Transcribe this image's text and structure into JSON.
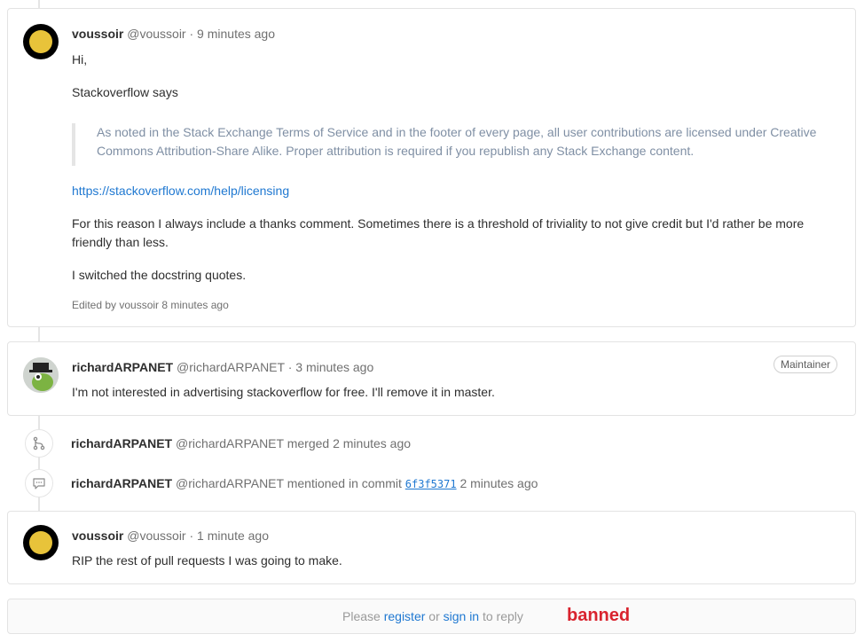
{
  "notes": [
    {
      "author": "voussoir",
      "handle": "@voussoir",
      "separator": "·",
      "time": "9 minutes ago",
      "paragraphs": {
        "greeting": "Hi,",
        "intro": "Stackoverflow says",
        "quote": "As noted in the Stack Exchange Terms of Service and in the footer of every page, all user contributions are licensed under Creative Commons Attribution-Share Alike. Proper attribution is required if you republish any Stack Exchange content.",
        "link": "https://stackoverflow.com/help/licensing",
        "reason": "For this reason I always include a thanks comment. Sometimes there is a threshold of triviality to not give credit but I'd rather be more friendly than less.",
        "closing": "I switched the docstring quotes."
      },
      "edited": "Edited by voussoir 8 minutes ago"
    },
    {
      "author": "richardARPANET",
      "handle": "@richardARPANET",
      "separator": "·",
      "time": "3 minutes ago",
      "badge": "Maintainer",
      "text": "I'm not interested in advertising stackoverflow for free. I'll remove it in master."
    },
    {
      "author": "voussoir",
      "handle": "@voussoir",
      "separator": "·",
      "time": "1 minute ago",
      "text": "RIP the rest of pull requests I was going to make."
    }
  ],
  "system_notes": [
    {
      "icon": "merge-icon",
      "author": "richardARPANET",
      "handle": "@richardARPANET",
      "action": "merged",
      "time": "2 minutes ago"
    },
    {
      "icon": "comment-icon",
      "author": "richardARPANET",
      "handle": "@richardARPANET",
      "action": "mentioned in commit",
      "commit": "6f3f5371",
      "time": "2 minutes ago"
    }
  ],
  "reply": {
    "please": "Please",
    "register": "register",
    "or": "or",
    "sign_in": "sign in",
    "to_reply": "to reply",
    "banned": "banned"
  },
  "colors": {
    "link": "#1f78d1",
    "banned": "#d9232e",
    "avatar_yellow": "#e8c33a"
  }
}
